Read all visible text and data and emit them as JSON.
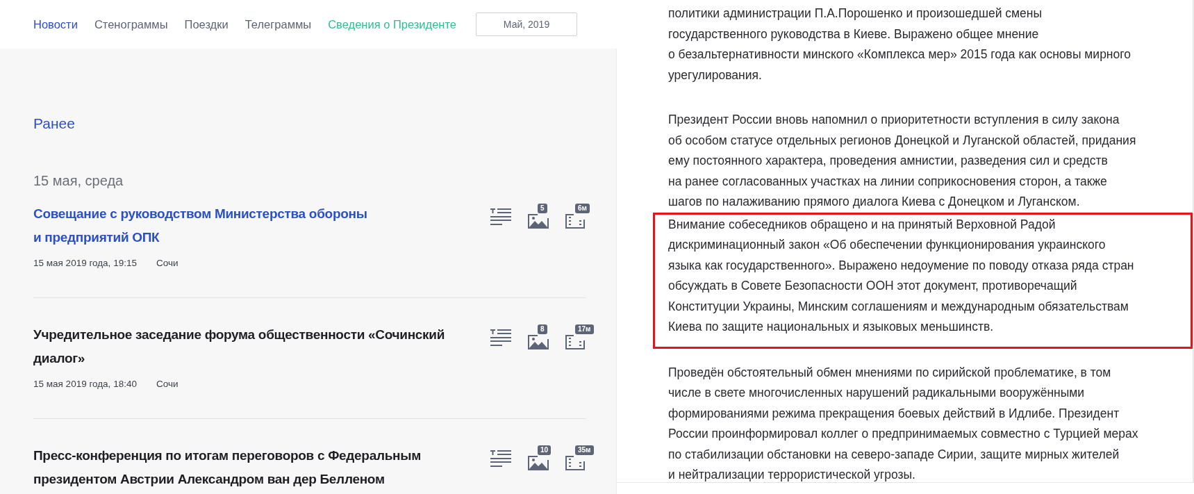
{
  "nav": {
    "items": [
      {
        "label": "Новости",
        "kind": "active"
      },
      {
        "label": "Стенограммы",
        "kind": "normal"
      },
      {
        "label": "Поездки",
        "kind": "normal"
      },
      {
        "label": "Телеграммы",
        "kind": "normal"
      },
      {
        "label": "Сведения о Президенте",
        "kind": "accent"
      }
    ],
    "month_button": "Май, 2019"
  },
  "feed": {
    "heading": "Ранее",
    "day": "15 мая, среда",
    "items": [
      {
        "title_lines": [
          "Совещание с руководством Министерства обороны",
          "и предприятий ОПК"
        ],
        "highlighted": true,
        "date": "15 мая 2019 года, 19:15",
        "place": "Сочи",
        "photos": "5",
        "video": "6м"
      },
      {
        "title_lines": [
          "Учредительное заседание форума общественности «Сочинский",
          "диалог»"
        ],
        "highlighted": false,
        "date": "15 мая 2019 года, 18:40",
        "place": "Сочи",
        "photos": "8",
        "video": "17м"
      },
      {
        "title_lines": [
          "Пресс-конференция по итогам переговоров с Федеральным",
          "президентом Австрии Александром ван дер Белленом"
        ],
        "highlighted": false,
        "photos": "10",
        "video": "35м"
      }
    ]
  },
  "article": {
    "paragraphs": [
      {
        "lines": [
          "политики администрации П.А.Порошенко и произошедшей смены",
          "государственного руководства в Киеве. Выражено общее мнение",
          "о безальтернативности минского «Комплекса мер» 2015 года как основы мирного",
          "урегулирования."
        ],
        "highlighted": false
      },
      {
        "lines": [
          "Президент России вновь напомнил о приоритетности вступления в силу закона",
          "об особом статусе отдельных регионов Донецкой и Луганской областей, придания",
          "ему постоянного характера, проведения амнистии, разведения сил и средств",
          "на ранее согласованных участках на линии соприкосновения сторон, а также",
          "шагов по налаживанию прямого диалога Киева с Донецком и Луганском."
        ],
        "highlighted": false
      },
      {
        "lines": [
          "Внимание собеседников обращено и на принятый Верховной Радой",
          "дискриминационный закон «Об обеспечении функционирования украинского",
          "языка как государственного». Выражено недоумение по поводу отказа ряда стран",
          "обсуждать в Совете Безопасности ООН этот документ, противоречащий",
          "Конституции Украины, Минским соглашениям и международным обязательствам",
          "Киева по защите национальных и языковых меньшинств."
        ],
        "highlighted": true
      },
      {
        "lines": [
          "Проведён обстоятельный обмен мнениями по сирийской проблематике, в том",
          "числе в свете многочисленных нарушений радикальными вооружёнными",
          "формированиями режима прекращения боевых действий в Идлибе. Президент",
          "России проинформировал коллег о предпринимаемых совместно с Турцией мерах",
          "по стабилизации обстановки на северо-западе Сирии, защите мирных жителей",
          "и нейтрализации террористической угрозы."
        ],
        "highlighted": false
      }
    ]
  }
}
